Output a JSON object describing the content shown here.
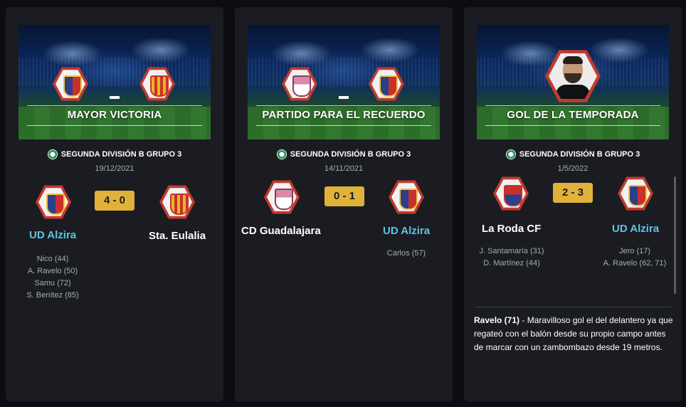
{
  "cards": [
    {
      "title": "MAYOR VICTORIA",
      "competition": "SEGUNDA DIVISIÓN B GRUPO 3",
      "date": "19/12/2021",
      "score": "4 - 0",
      "home": {
        "name": "UD Alzira",
        "crest": "alzira-crest",
        "scorers": [
          "Nico (44)",
          "A. Ravelo (50)",
          "Samu (72)",
          "S. Benítez (85)"
        ]
      },
      "away": {
        "name": "Sta. Eulalia",
        "crest": "eulalia-crest",
        "scorers": []
      }
    },
    {
      "title": "PARTIDO PARA EL RECUERDO",
      "competition": "SEGUNDA DIVISIÓN B GRUPO 3",
      "date": "14/11/2021",
      "score": "0 - 1",
      "home": {
        "name": "CD Guadalajara",
        "crest": "guadalajara-crest",
        "scorers": []
      },
      "away": {
        "name": "UD Alzira",
        "crest": "alzira-crest",
        "scorers": [
          "Carlos (57)"
        ]
      }
    },
    {
      "title": "GOL DE LA TEMPORADA",
      "competition": "SEGUNDA DIVISIÓN B GRUPO 3",
      "date": "1/5/2022",
      "score": "2 - 3",
      "home": {
        "name": "La Roda CF",
        "crest": "laroda-crest",
        "scorers": [
          "J. Santamaría (31)",
          "D. Martínez (44)"
        ]
      },
      "away": {
        "name": "UD Alzira",
        "crest": "alzira-crest",
        "scorers": [
          "Jero (17)",
          "A. Ravelo (62, 71)"
        ]
      },
      "goal_scorer": "Ravelo (71)",
      "goal_description": " - Maravilloso gol el del delantero ya que regateó con el balón desde su propio campo antes de marcar con un zambombazo desde 19 metros."
    }
  ],
  "colors": {
    "accent": "#5fc4e0",
    "score_bg": "#e0b23a",
    "card_bg": "#1a1c22",
    "page_bg": "#0b0d12"
  }
}
